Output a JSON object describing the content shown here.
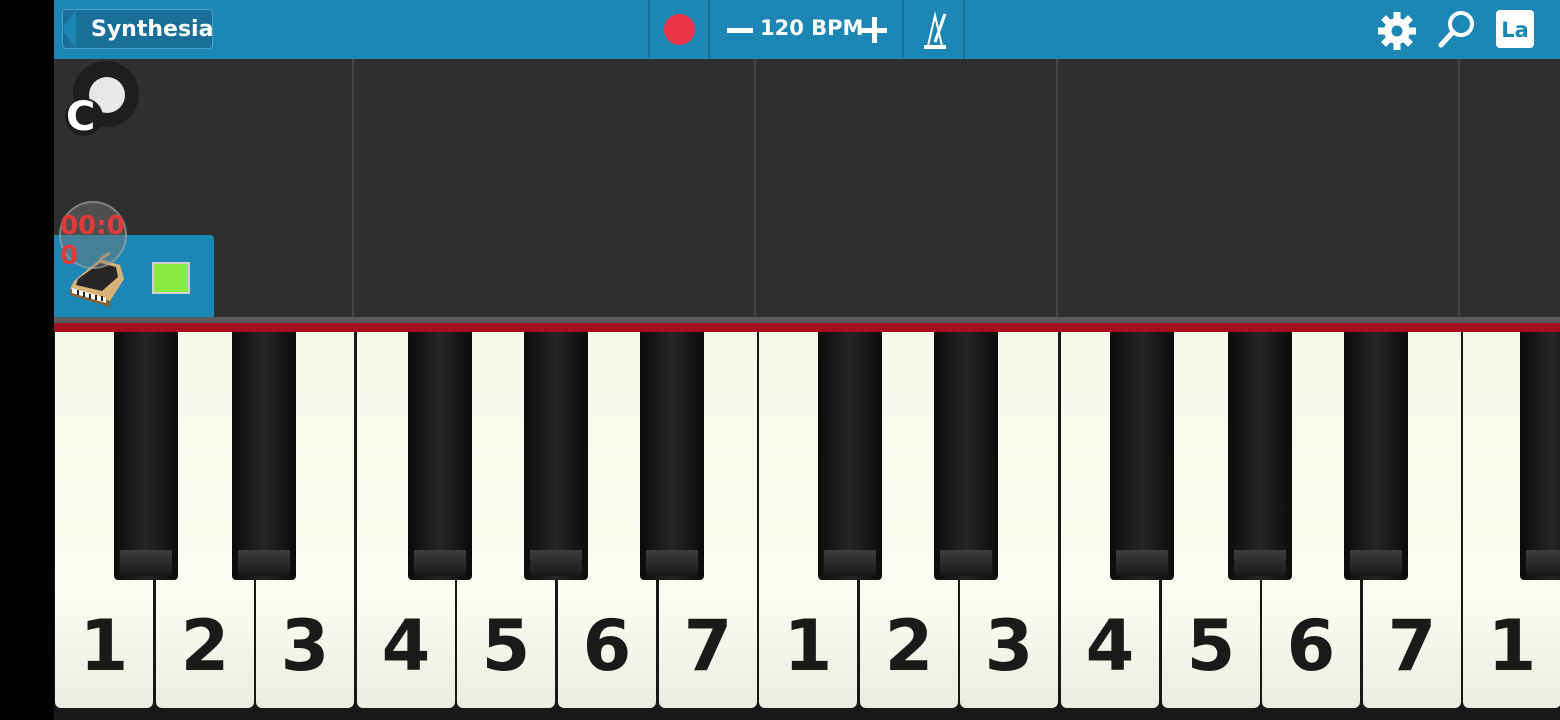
{
  "topbar": {
    "back_label": "Synthesia",
    "bpm_label": "120 BPM",
    "language_label": "La",
    "record_color": "#ea3349",
    "bar_color": "#1c87b5"
  },
  "note_area": {
    "key_signature": "C",
    "timer": "00:00",
    "track_color": "#8aec41"
  },
  "keyboard": {
    "white_keys": [
      "1",
      "2",
      "3",
      "4",
      "5",
      "6",
      "7",
      "1",
      "2",
      "3",
      "4",
      "5",
      "6",
      "7",
      "1"
    ]
  },
  "icons": [
    "back-arrow-icon",
    "record-icon",
    "minus-icon",
    "plus-icon",
    "metronome-icon",
    "gear-icon",
    "search-icon",
    "language-icon",
    "key-signature-icon",
    "piano-icon"
  ]
}
